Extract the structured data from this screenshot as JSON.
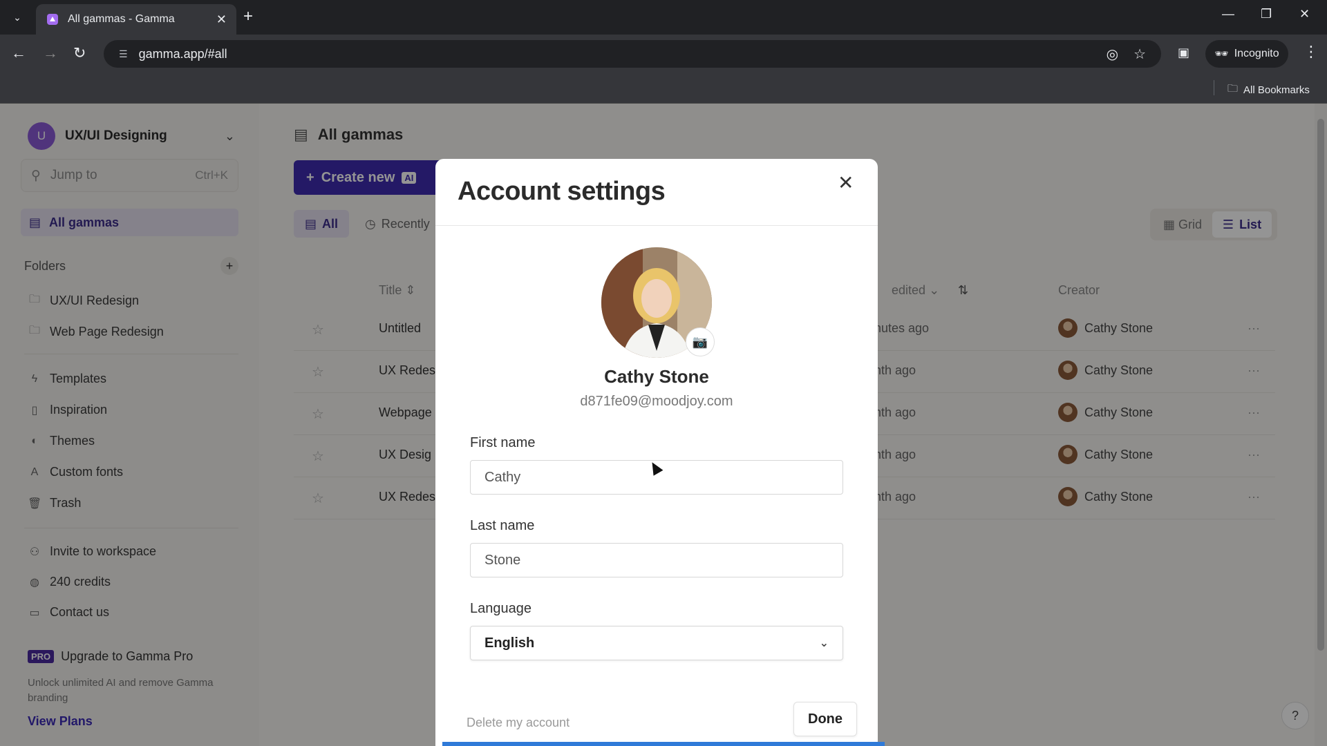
{
  "browser": {
    "tab_title": "All gammas - Gamma",
    "url": "gamma.app/#all",
    "incognito_label": "Incognito",
    "bookmarks_label": "All Bookmarks",
    "new_tab": "+",
    "tab_close": "✕"
  },
  "sidebar": {
    "workspace_initial": "U",
    "workspace_name": "UX/UI Designing",
    "jump_placeholder": "Jump to",
    "jump_shortcut": "Ctrl+K",
    "active_item": "All gammas",
    "folders_label": "Folders",
    "folders": [
      "UX/UI Redesign",
      "Web Page Redesign"
    ],
    "links": [
      "Templates",
      "Inspiration",
      "Themes",
      "Custom fonts",
      "Trash"
    ],
    "bottom": [
      "Invite to workspace",
      "240 credits",
      "Contact us"
    ],
    "pro_badge": "PRO",
    "upgrade_title": "Upgrade to Gamma Pro",
    "upgrade_desc": "Unlock unlimited AI and remove Gamma branding",
    "view_plans": "View Plans"
  },
  "main": {
    "title": "All gammas",
    "create_label": "Create new",
    "ai_badge": "AI",
    "filter_all": "All",
    "filter_recent": "Recently",
    "view_grid": "Grid",
    "view_list": "List",
    "col_title": "Title",
    "col_edited": "edited",
    "col_creator": "Creator",
    "rows": [
      {
        "title": "Untitled",
        "edited": "nutes ago",
        "creator": "Cathy Stone"
      },
      {
        "title": "UX Redes",
        "edited": "nth ago",
        "creator": "Cathy Stone"
      },
      {
        "title": "Webpage",
        "edited": "nth ago",
        "creator": "Cathy Stone"
      },
      {
        "title": "UX Desig",
        "edited": "nth ago",
        "creator": "Cathy Stone"
      },
      {
        "title": "UX Redes",
        "edited": "nth ago",
        "creator": "Cathy Stone"
      }
    ],
    "help": "?"
  },
  "modal": {
    "title": "Account settings",
    "name": "Cathy Stone",
    "email": "d871fe09@moodjoy.com",
    "first_name_label": "First name",
    "first_name_value": "Cathy",
    "last_name_label": "Last name",
    "last_name_value": "Stone",
    "language_label": "Language",
    "language_value": "English",
    "delete_label": "Delete my account",
    "done_label": "Done"
  },
  "colors": {
    "accent": "#3e2bb0",
    "active_bg": "#e5e1f0",
    "progress": "#2f7ad8"
  }
}
